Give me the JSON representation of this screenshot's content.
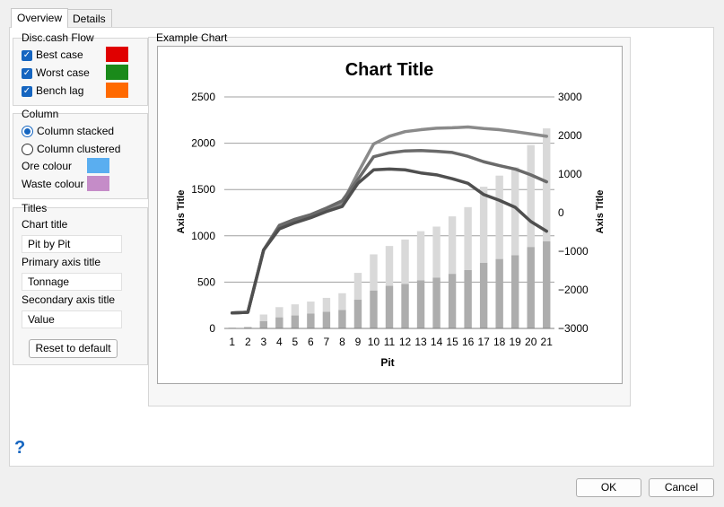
{
  "tabs": [
    {
      "label": "Overview"
    },
    {
      "label": "Details"
    }
  ],
  "cashflow": {
    "title": "Disc.cash Flow",
    "items": [
      {
        "label": "Best case",
        "color": "#e00000"
      },
      {
        "label": "Worst case",
        "color": "#1a8a1a"
      },
      {
        "label": "Bench lag",
        "color": "#ff6a00"
      }
    ]
  },
  "column": {
    "title": "Column",
    "options": [
      {
        "label": "Column stacked",
        "selected": true
      },
      {
        "label": "Column clustered",
        "selected": false
      }
    ],
    "ore_label": "Ore colour",
    "ore_color": "#5aaef0",
    "waste_label": "Waste colour",
    "waste_color": "#c58cc8"
  },
  "titles": {
    "title": "Titles",
    "chart_title_label": "Chart title",
    "chart_title_value": "Pit by Pit",
    "primary_label": "Primary axis title",
    "primary_value": "Tonnage",
    "secondary_label": "Secondary axis title",
    "secondary_value": "Value",
    "reset_label": "Reset to default"
  },
  "example_label": "Example Chart",
  "help_glyph": "?",
  "buttons": {
    "ok": "OK",
    "cancel": "Cancel"
  },
  "chart_data": {
    "type": "bar",
    "title": "Chart Title",
    "xlabel": "Pit",
    "ylabel": "Axis Title",
    "y2label": "Axis Title",
    "categories": [
      "1",
      "2",
      "3",
      "4",
      "5",
      "6",
      "7",
      "8",
      "9",
      "10",
      "11",
      "12",
      "13",
      "14",
      "15",
      "16",
      "17",
      "18",
      "19",
      "20",
      "21"
    ],
    "ylim": [
      0,
      2500
    ],
    "yticks": [
      "0",
      "500",
      "1000",
      "1500",
      "2000",
      "2500"
    ],
    "y2lim": [
      -3000,
      3000
    ],
    "y2ticks": [
      "-3000",
      "-2000",
      "-1000",
      "0",
      "1000",
      "2000",
      "3000"
    ],
    "bar_series": [
      {
        "values": [
          5,
          10,
          80,
          120,
          140,
          160,
          180,
          200,
          310,
          410,
          460,
          480,
          520,
          550,
          590,
          630,
          710,
          750,
          790,
          880,
          940
        ],
        "color": "#adadad"
      },
      {
        "values": [
          5,
          10,
          70,
          110,
          120,
          130,
          150,
          180,
          290,
          390,
          430,
          480,
          530,
          550,
          620,
          680,
          820,
          900,
          950,
          1100,
          1220
        ],
        "color": "#d9d9d9"
      }
    ],
    "line_series": [
      {
        "values": [
          -2600,
          -2580,
          -970,
          -350,
          -200,
          -80,
          80,
          240,
          1030,
          1780,
          1980,
          2100,
          2150,
          2190,
          2200,
          2220,
          2180,
          2150,
          2100,
          2040,
          1980
        ],
        "color": "#8a8a8a"
      },
      {
        "values": [
          -2600,
          -2580,
          -970,
          -330,
          -170,
          -50,
          120,
          310,
          860,
          1450,
          1550,
          1600,
          1610,
          1590,
          1560,
          1460,
          1320,
          1220,
          1130,
          980,
          800
        ],
        "color": "#6a6a6a"
      },
      {
        "values": [
          -2600,
          -2580,
          -970,
          -420,
          -260,
          -130,
          30,
          160,
          760,
          1110,
          1130,
          1110,
          1030,
          980,
          880,
          760,
          470,
          320,
          140,
          -230,
          -480
        ],
        "color": "#4f4f4f"
      }
    ]
  }
}
